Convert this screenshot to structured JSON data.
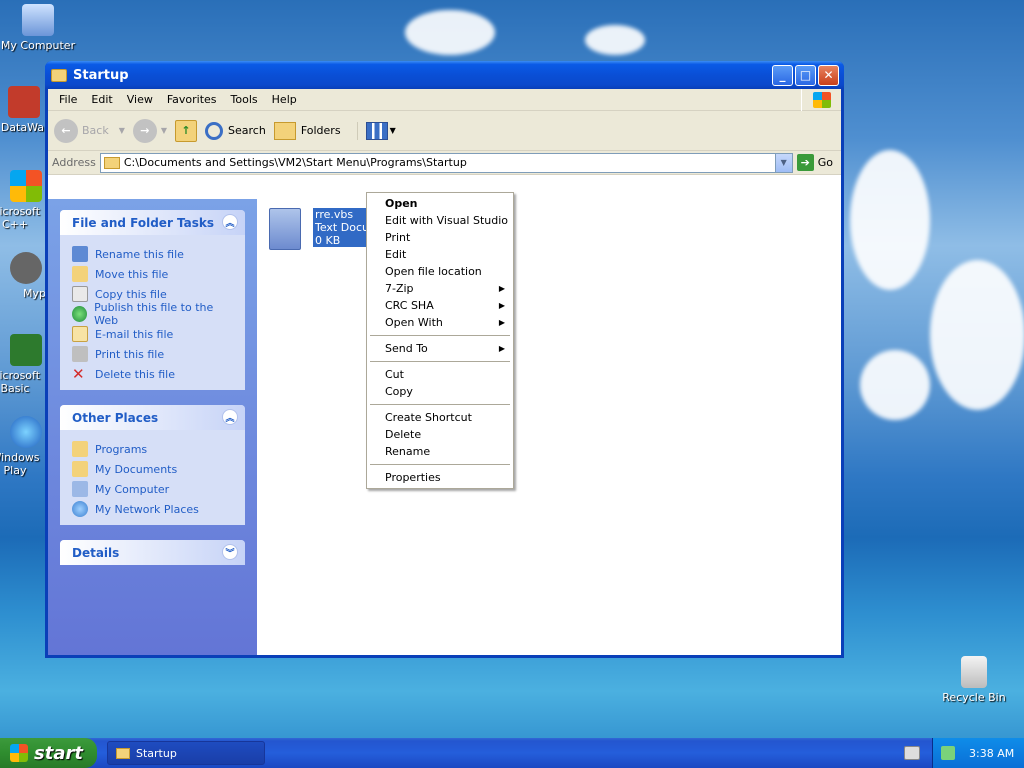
{
  "desktop": {
    "icons": [
      {
        "label": "My Computer"
      },
      {
        "label": "DataWa"
      },
      {
        "label": "Microsoft C++"
      },
      {
        "label": "Myp"
      },
      {
        "label": "Microsoft Basic"
      },
      {
        "label": "Windows Play"
      },
      {
        "label": "Recycle Bin"
      }
    ]
  },
  "window": {
    "title": "Startup",
    "menu": [
      "File",
      "Edit",
      "View",
      "Favorites",
      "Tools",
      "Help"
    ],
    "toolbar": {
      "back": "Back",
      "search": "Search",
      "folders": "Folders"
    },
    "address": {
      "label": "Address",
      "value": "C:\\Documents and Settings\\VM2\\Start Menu\\Programs\\Startup",
      "go": "Go"
    }
  },
  "left_pane": {
    "file_tasks": {
      "title": "File and Folder Tasks",
      "items": [
        "Rename this file",
        "Move this file",
        "Copy this file",
        "Publish this file to the Web",
        "E-mail this file",
        "Print this file",
        "Delete this file"
      ]
    },
    "other_places": {
      "title": "Other Places",
      "items": [
        "Programs",
        "My Documents",
        "My Computer",
        "My Network Places"
      ]
    },
    "details": {
      "title": "Details"
    }
  },
  "file": {
    "name": "rre.vbs",
    "type": "Text Docu",
    "size": "0 KB"
  },
  "context_menu": {
    "items": [
      {
        "label": "Open",
        "bold": true
      },
      {
        "label": "Edit with Visual Studio"
      },
      {
        "label": "Print"
      },
      {
        "label": "Edit"
      },
      {
        "label": "Open file location"
      },
      {
        "label": "7-Zip",
        "submenu": true
      },
      {
        "label": "CRC SHA",
        "submenu": true
      },
      {
        "label": "Open With",
        "submenu": true
      },
      {
        "sep": true
      },
      {
        "label": "Send To",
        "submenu": true
      },
      {
        "sep": true
      },
      {
        "label": "Cut"
      },
      {
        "label": "Copy"
      },
      {
        "sep": true
      },
      {
        "label": "Create Shortcut"
      },
      {
        "label": "Delete"
      },
      {
        "label": "Rename"
      },
      {
        "sep": true
      },
      {
        "label": "Properties"
      }
    ]
  },
  "taskbar": {
    "start": "start",
    "task": "Startup",
    "clock": "3:38 AM"
  }
}
